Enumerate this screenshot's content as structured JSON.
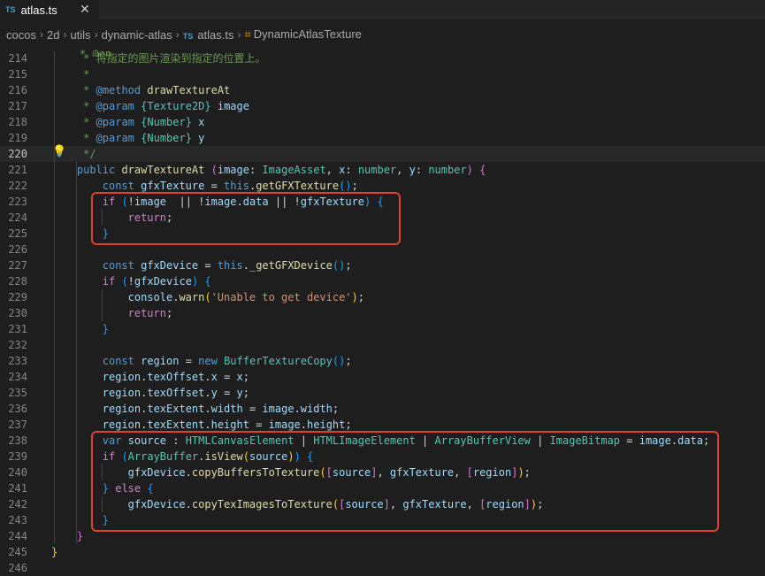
{
  "tab": {
    "badge": "TS",
    "label": "atlas.ts",
    "close": "✕"
  },
  "breadcrumbs": [
    {
      "label": "cocos"
    },
    {
      "label": "2d"
    },
    {
      "label": "utils"
    },
    {
      "label": "dynamic-atlas"
    },
    {
      "label": "atlas.ts",
      "icon": "TS"
    },
    {
      "label": "DynamicAtlasTexture",
      "icon": "symbol-class-icon"
    }
  ],
  "current_line": 220,
  "lines": [
    {
      "n": "214",
      "tokens": [
        [
          "cm",
          "* 将指定的图片渲染到指定的位置上。"
        ]
      ]
    },
    {
      "n": "215",
      "tokens": [
        [
          "cm",
          "*"
        ]
      ]
    },
    {
      "n": "216",
      "tokens": [
        [
          "cm",
          "* "
        ],
        [
          "kw",
          "@method"
        ],
        [
          "fn",
          " drawTextureAt"
        ]
      ]
    },
    {
      "n": "217",
      "tokens": [
        [
          "cm",
          "* "
        ],
        [
          "kw",
          "@param"
        ],
        [
          "cm",
          " "
        ],
        [
          "ty",
          "{Texture2D}"
        ],
        [
          "var",
          " image"
        ]
      ]
    },
    {
      "n": "218",
      "tokens": [
        [
          "cm",
          "* "
        ],
        [
          "kw",
          "@param"
        ],
        [
          "cm",
          " "
        ],
        [
          "ty",
          "{Number}"
        ],
        [
          "var",
          " x"
        ]
      ]
    },
    {
      "n": "219",
      "tokens": [
        [
          "cm",
          "* "
        ],
        [
          "kw",
          "@param"
        ],
        [
          "cm",
          " "
        ],
        [
          "ty",
          "{Number}"
        ],
        [
          "var",
          " y"
        ]
      ]
    },
    {
      "n": "220",
      "tokens": [
        [
          "cm",
          "*/"
        ]
      ]
    },
    {
      "n": "221",
      "tokens": [
        [
          "kw",
          "public "
        ],
        [
          "fn",
          "drawTextureAt"
        ],
        [
          "op",
          " "
        ],
        [
          "br2",
          "("
        ],
        [
          "var",
          "image"
        ],
        [
          "op",
          ": "
        ],
        [
          "ty",
          "ImageAsset"
        ],
        [
          "op",
          ", "
        ],
        [
          "var",
          "x"
        ],
        [
          "op",
          ": "
        ],
        [
          "ty",
          "number"
        ],
        [
          "op",
          ", "
        ],
        [
          "var",
          "y"
        ],
        [
          "op",
          ": "
        ],
        [
          "ty",
          "number"
        ],
        [
          "br2",
          ")"
        ],
        [
          "op",
          " "
        ],
        [
          "br2",
          "{"
        ]
      ]
    },
    {
      "n": "222",
      "tokens": [
        [
          "kw",
          "const "
        ],
        [
          "var",
          "gfxTexture"
        ],
        [
          "op",
          " = "
        ],
        [
          "kw",
          "this"
        ],
        [
          "op",
          "."
        ],
        [
          "fn",
          "getGFXTexture"
        ],
        [
          "br3",
          "()"
        ],
        [
          "op",
          ";"
        ]
      ]
    },
    {
      "n": "223",
      "tokens": [
        [
          "ctl",
          "if "
        ],
        [
          "br3",
          "("
        ],
        [
          "op",
          "!"
        ],
        [
          "var",
          "image"
        ],
        [
          "op",
          "  || !"
        ],
        [
          "var",
          "image"
        ],
        [
          "op",
          "."
        ],
        [
          "var",
          "data"
        ],
        [
          "op",
          " || !"
        ],
        [
          "var",
          "gfxTexture"
        ],
        [
          "br3",
          ")"
        ],
        [
          "op",
          " "
        ],
        [
          "br3",
          "{"
        ]
      ]
    },
    {
      "n": "224",
      "tokens": [
        [
          "ctl",
          "return"
        ],
        [
          "op",
          ";"
        ]
      ]
    },
    {
      "n": "225",
      "tokens": [
        [
          "br3",
          "}"
        ]
      ]
    },
    {
      "n": "226",
      "tokens": []
    },
    {
      "n": "227",
      "tokens": [
        [
          "kw",
          "const "
        ],
        [
          "var",
          "gfxDevice"
        ],
        [
          "op",
          " = "
        ],
        [
          "kw",
          "this"
        ],
        [
          "op",
          "."
        ],
        [
          "fn",
          "_getGFXDevice"
        ],
        [
          "br3",
          "()"
        ],
        [
          "op",
          ";"
        ]
      ]
    },
    {
      "n": "228",
      "tokens": [
        [
          "ctl",
          "if "
        ],
        [
          "br3",
          "("
        ],
        [
          "op",
          "!"
        ],
        [
          "var",
          "gfxDevice"
        ],
        [
          "br3",
          ")"
        ],
        [
          "op",
          " "
        ],
        [
          "br3",
          "{"
        ]
      ]
    },
    {
      "n": "229",
      "tokens": [
        [
          "var",
          "console"
        ],
        [
          "op",
          "."
        ],
        [
          "fn",
          "warn"
        ],
        [
          "br1",
          "("
        ],
        [
          "str",
          "'Unable to get device'"
        ],
        [
          "br1",
          ")"
        ],
        [
          "op",
          ";"
        ]
      ]
    },
    {
      "n": "230",
      "tokens": [
        [
          "ctl",
          "return"
        ],
        [
          "op",
          ";"
        ]
      ]
    },
    {
      "n": "231",
      "tokens": [
        [
          "br3",
          "}"
        ]
      ]
    },
    {
      "n": "232",
      "tokens": []
    },
    {
      "n": "233",
      "tokens": [
        [
          "kw",
          "const "
        ],
        [
          "var",
          "region"
        ],
        [
          "op",
          " = "
        ],
        [
          "kw",
          "new "
        ],
        [
          "ty",
          "BufferTextureCopy"
        ],
        [
          "br3",
          "()"
        ],
        [
          "op",
          ";"
        ]
      ]
    },
    {
      "n": "234",
      "tokens": [
        [
          "var",
          "region"
        ],
        [
          "op",
          "."
        ],
        [
          "var",
          "texOffset"
        ],
        [
          "op",
          "."
        ],
        [
          "var",
          "x"
        ],
        [
          "op",
          " = "
        ],
        [
          "var",
          "x"
        ],
        [
          "op",
          ";"
        ]
      ]
    },
    {
      "n": "235",
      "tokens": [
        [
          "var",
          "region"
        ],
        [
          "op",
          "."
        ],
        [
          "var",
          "texOffset"
        ],
        [
          "op",
          "."
        ],
        [
          "var",
          "y"
        ],
        [
          "op",
          " = "
        ],
        [
          "var",
          "y"
        ],
        [
          "op",
          ";"
        ]
      ]
    },
    {
      "n": "236",
      "tokens": [
        [
          "var",
          "region"
        ],
        [
          "op",
          "."
        ],
        [
          "var",
          "texExtent"
        ],
        [
          "op",
          "."
        ],
        [
          "var",
          "width"
        ],
        [
          "op",
          " = "
        ],
        [
          "var",
          "image"
        ],
        [
          "op",
          "."
        ],
        [
          "var",
          "width"
        ],
        [
          "op",
          ";"
        ]
      ]
    },
    {
      "n": "237",
      "tokens": [
        [
          "var",
          "region"
        ],
        [
          "op",
          "."
        ],
        [
          "var",
          "texExtent"
        ],
        [
          "op",
          "."
        ],
        [
          "var",
          "height"
        ],
        [
          "op",
          " = "
        ],
        [
          "var",
          "image"
        ],
        [
          "op",
          "."
        ],
        [
          "var",
          "height"
        ],
        [
          "op",
          ";"
        ]
      ]
    },
    {
      "n": "238",
      "tokens": [
        [
          "kw",
          "var "
        ],
        [
          "var",
          "source"
        ],
        [
          "op",
          " : "
        ],
        [
          "ty",
          "HTMLCanvasElement"
        ],
        [
          "op",
          " | "
        ],
        [
          "ty",
          "HTMLImageElement"
        ],
        [
          "op",
          " | "
        ],
        [
          "ty",
          "ArrayBufferView"
        ],
        [
          "op",
          " | "
        ],
        [
          "ty",
          "ImageBitmap"
        ],
        [
          "op",
          " = "
        ],
        [
          "var",
          "image"
        ],
        [
          "op",
          "."
        ],
        [
          "var",
          "data"
        ],
        [
          "op",
          ";"
        ]
      ]
    },
    {
      "n": "239",
      "tokens": [
        [
          "ctl",
          "if "
        ],
        [
          "br3",
          "("
        ],
        [
          "ty",
          "ArrayBuffer"
        ],
        [
          "op",
          "."
        ],
        [
          "fn",
          "isView"
        ],
        [
          "br1",
          "("
        ],
        [
          "var",
          "source"
        ],
        [
          "br1",
          ")"
        ],
        [
          "br3",
          ")"
        ],
        [
          "op",
          " "
        ],
        [
          "br3",
          "{"
        ]
      ]
    },
    {
      "n": "240",
      "tokens": [
        [
          "var",
          "gfxDevice"
        ],
        [
          "op",
          "."
        ],
        [
          "fn",
          "copyBuffersToTexture"
        ],
        [
          "br1",
          "("
        ],
        [
          "br2",
          "["
        ],
        [
          "var",
          "source"
        ],
        [
          "br2",
          "]"
        ],
        [
          "op",
          ", "
        ],
        [
          "var",
          "gfxTexture"
        ],
        [
          "op",
          ", "
        ],
        [
          "br2",
          "["
        ],
        [
          "var",
          "region"
        ],
        [
          "br2",
          "]"
        ],
        [
          "br1",
          ")"
        ],
        [
          "op",
          ";"
        ]
      ]
    },
    {
      "n": "241",
      "tokens": [
        [
          "br3",
          "}"
        ],
        [
          "op",
          " "
        ],
        [
          "ctl",
          "else "
        ],
        [
          "br3",
          "{"
        ]
      ]
    },
    {
      "n": "242",
      "tokens": [
        [
          "var",
          "gfxDevice"
        ],
        [
          "op",
          "."
        ],
        [
          "fn",
          "copyTexImagesToTexture"
        ],
        [
          "br1",
          "("
        ],
        [
          "br2",
          "["
        ],
        [
          "var",
          "source"
        ],
        [
          "br2",
          "]"
        ],
        [
          "op",
          ", "
        ],
        [
          "var",
          "gfxTexture"
        ],
        [
          "op",
          ", "
        ],
        [
          "br2",
          "["
        ],
        [
          "var",
          "region"
        ],
        [
          "br2",
          "]"
        ],
        [
          "br1",
          ")"
        ],
        [
          "op",
          ";"
        ]
      ]
    },
    {
      "n": "243",
      "tokens": [
        [
          "br3",
          "}"
        ]
      ]
    },
    {
      "n": "244",
      "tokens": [
        [
          "br2",
          "}"
        ]
      ]
    },
    {
      "n": "245",
      "tokens": [
        [
          "br1",
          "}"
        ]
      ]
    },
    {
      "n": "246",
      "tokens": []
    }
  ],
  "top_partial_line": "* @en"
}
